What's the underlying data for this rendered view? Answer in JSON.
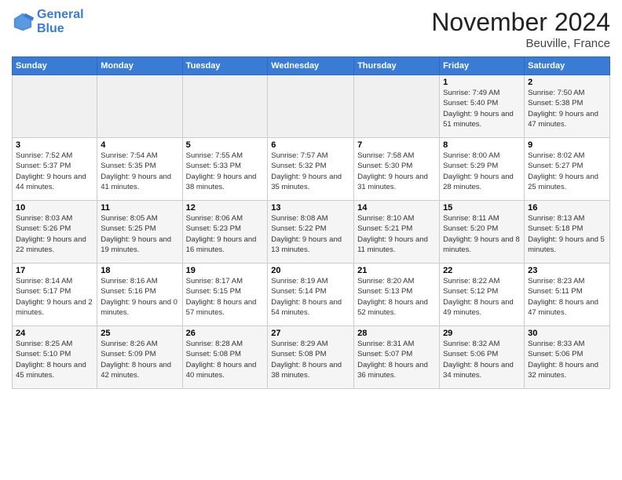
{
  "logo": {
    "line1": "General",
    "line2": "Blue"
  },
  "title": "November 2024",
  "location": "Beuville, France",
  "days_header": [
    "Sunday",
    "Monday",
    "Tuesday",
    "Wednesday",
    "Thursday",
    "Friday",
    "Saturday"
  ],
  "weeks": [
    [
      {
        "day": "",
        "info": ""
      },
      {
        "day": "",
        "info": ""
      },
      {
        "day": "",
        "info": ""
      },
      {
        "day": "",
        "info": ""
      },
      {
        "day": "",
        "info": ""
      },
      {
        "day": "1",
        "info": "Sunrise: 7:49 AM\nSunset: 5:40 PM\nDaylight: 9 hours and 51 minutes."
      },
      {
        "day": "2",
        "info": "Sunrise: 7:50 AM\nSunset: 5:38 PM\nDaylight: 9 hours and 47 minutes."
      }
    ],
    [
      {
        "day": "3",
        "info": "Sunrise: 7:52 AM\nSunset: 5:37 PM\nDaylight: 9 hours and 44 minutes."
      },
      {
        "day": "4",
        "info": "Sunrise: 7:54 AM\nSunset: 5:35 PM\nDaylight: 9 hours and 41 minutes."
      },
      {
        "day": "5",
        "info": "Sunrise: 7:55 AM\nSunset: 5:33 PM\nDaylight: 9 hours and 38 minutes."
      },
      {
        "day": "6",
        "info": "Sunrise: 7:57 AM\nSunset: 5:32 PM\nDaylight: 9 hours and 35 minutes."
      },
      {
        "day": "7",
        "info": "Sunrise: 7:58 AM\nSunset: 5:30 PM\nDaylight: 9 hours and 31 minutes."
      },
      {
        "day": "8",
        "info": "Sunrise: 8:00 AM\nSunset: 5:29 PM\nDaylight: 9 hours and 28 minutes."
      },
      {
        "day": "9",
        "info": "Sunrise: 8:02 AM\nSunset: 5:27 PM\nDaylight: 9 hours and 25 minutes."
      }
    ],
    [
      {
        "day": "10",
        "info": "Sunrise: 8:03 AM\nSunset: 5:26 PM\nDaylight: 9 hours and 22 minutes."
      },
      {
        "day": "11",
        "info": "Sunrise: 8:05 AM\nSunset: 5:25 PM\nDaylight: 9 hours and 19 minutes."
      },
      {
        "day": "12",
        "info": "Sunrise: 8:06 AM\nSunset: 5:23 PM\nDaylight: 9 hours and 16 minutes."
      },
      {
        "day": "13",
        "info": "Sunrise: 8:08 AM\nSunset: 5:22 PM\nDaylight: 9 hours and 13 minutes."
      },
      {
        "day": "14",
        "info": "Sunrise: 8:10 AM\nSunset: 5:21 PM\nDaylight: 9 hours and 11 minutes."
      },
      {
        "day": "15",
        "info": "Sunrise: 8:11 AM\nSunset: 5:20 PM\nDaylight: 9 hours and 8 minutes."
      },
      {
        "day": "16",
        "info": "Sunrise: 8:13 AM\nSunset: 5:18 PM\nDaylight: 9 hours and 5 minutes."
      }
    ],
    [
      {
        "day": "17",
        "info": "Sunrise: 8:14 AM\nSunset: 5:17 PM\nDaylight: 9 hours and 2 minutes."
      },
      {
        "day": "18",
        "info": "Sunrise: 8:16 AM\nSunset: 5:16 PM\nDaylight: 9 hours and 0 minutes."
      },
      {
        "day": "19",
        "info": "Sunrise: 8:17 AM\nSunset: 5:15 PM\nDaylight: 8 hours and 57 minutes."
      },
      {
        "day": "20",
        "info": "Sunrise: 8:19 AM\nSunset: 5:14 PM\nDaylight: 8 hours and 54 minutes."
      },
      {
        "day": "21",
        "info": "Sunrise: 8:20 AM\nSunset: 5:13 PM\nDaylight: 8 hours and 52 minutes."
      },
      {
        "day": "22",
        "info": "Sunrise: 8:22 AM\nSunset: 5:12 PM\nDaylight: 8 hours and 49 minutes."
      },
      {
        "day": "23",
        "info": "Sunrise: 8:23 AM\nSunset: 5:11 PM\nDaylight: 8 hours and 47 minutes."
      }
    ],
    [
      {
        "day": "24",
        "info": "Sunrise: 8:25 AM\nSunset: 5:10 PM\nDaylight: 8 hours and 45 minutes."
      },
      {
        "day": "25",
        "info": "Sunrise: 8:26 AM\nSunset: 5:09 PM\nDaylight: 8 hours and 42 minutes."
      },
      {
        "day": "26",
        "info": "Sunrise: 8:28 AM\nSunset: 5:08 PM\nDaylight: 8 hours and 40 minutes."
      },
      {
        "day": "27",
        "info": "Sunrise: 8:29 AM\nSunset: 5:08 PM\nDaylight: 8 hours and 38 minutes."
      },
      {
        "day": "28",
        "info": "Sunrise: 8:31 AM\nSunset: 5:07 PM\nDaylight: 8 hours and 36 minutes."
      },
      {
        "day": "29",
        "info": "Sunrise: 8:32 AM\nSunset: 5:06 PM\nDaylight: 8 hours and 34 minutes."
      },
      {
        "day": "30",
        "info": "Sunrise: 8:33 AM\nSunset: 5:06 PM\nDaylight: 8 hours and 32 minutes."
      }
    ]
  ]
}
